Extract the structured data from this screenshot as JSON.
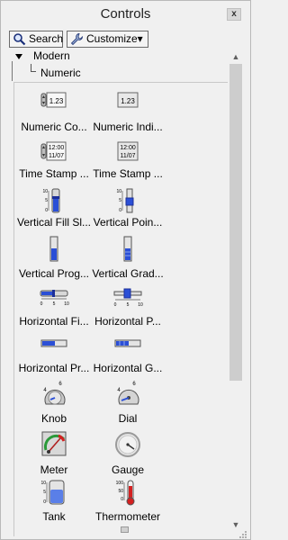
{
  "window": {
    "title": "Controls",
    "close_label": "x"
  },
  "toolbar": {
    "search_label": "Search",
    "customize_label": "Customize▾"
  },
  "tree": {
    "root_label": "Modern",
    "child_label": "Numeric"
  },
  "palette": {
    "items": [
      {
        "label": "Numeric Co...",
        "icon": "numeric-control-icon"
      },
      {
        "label": "Numeric Indi...",
        "icon": "numeric-indicator-icon"
      },
      {
        "label": "Time Stamp ...",
        "icon": "time-stamp-control-icon"
      },
      {
        "label": "Time Stamp ...",
        "icon": "time-stamp-indicator-icon"
      },
      {
        "label": "Vertical Fill Sl...",
        "icon": "vertical-fill-slide-icon"
      },
      {
        "label": "Vertical Poin...",
        "icon": "vertical-pointer-slide-icon"
      },
      {
        "label": "Vertical Prog...",
        "icon": "vertical-progress-bar-icon"
      },
      {
        "label": "Vertical Grad...",
        "icon": "vertical-graduated-bar-icon"
      },
      {
        "label": "Horizontal Fi...",
        "icon": "horizontal-fill-slide-icon"
      },
      {
        "label": "Horizontal P...",
        "icon": "horizontal-pointer-slide-icon"
      },
      {
        "label": "Horizontal Pr...",
        "icon": "horizontal-progress-bar-icon"
      },
      {
        "label": "Horizontal G...",
        "icon": "horizontal-graduated-bar-icon"
      },
      {
        "label": "Knob",
        "icon": "knob-icon"
      },
      {
        "label": "Dial",
        "icon": "dial-icon"
      },
      {
        "label": "Meter",
        "icon": "meter-icon"
      },
      {
        "label": "Gauge",
        "icon": "gauge-icon"
      },
      {
        "label": "Tank",
        "icon": "tank-icon"
      },
      {
        "label": "Thermometer",
        "icon": "thermometer-icon"
      }
    ],
    "numeric_value": "1.23",
    "time_top": "12:00",
    "time_bottom": "11/07",
    "scale_top": "10",
    "scale_mid": "5",
    "scale_bottom": "0",
    "knob_scale_top": "6",
    "knob_scale_bottom": "4",
    "thermometer_top": "100",
    "thermometer_mid": "50",
    "thermometer_bottom": "0"
  },
  "colors": {
    "accent_blue": "#2b4fd6",
    "dark_blue": "#1c2f99",
    "fill_blue": "#5a7fe8",
    "thermometer_red": "#d42020",
    "gauge_gray": "#9a9a9a"
  }
}
